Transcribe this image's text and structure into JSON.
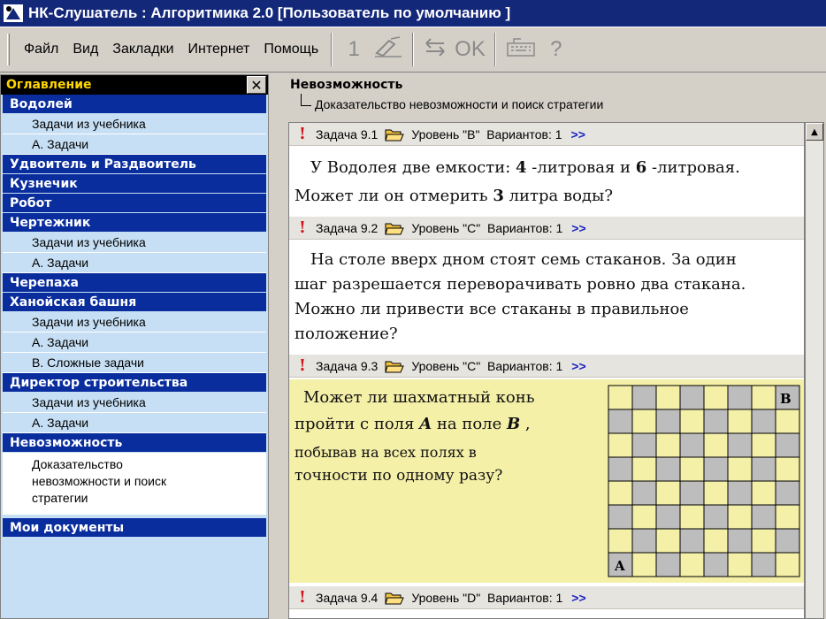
{
  "window": {
    "title": "НК-Слушатель : Алгоритмика 2.0 [Пользователь по умолчанию ]"
  },
  "menu": {
    "items": [
      "Файл",
      "Вид",
      "Закладки",
      "Интернет",
      "Помощь"
    ]
  },
  "toolbar": {
    "btn_one": "1",
    "btn_ok": "OK",
    "btn_help": "?"
  },
  "sidebar": {
    "header": "Оглавление",
    "close": "✕",
    "cat_vodoley": "Водолей",
    "sub_vodoley_1": "Задачи из учебника",
    "sub_vodoley_2": "А. Задачи",
    "cat_udvoitel": "Удвоитель и Раздвоитель",
    "cat_kuznechik": "Кузнечик",
    "cat_robot": "Робот",
    "cat_chertezhnik": "Чертежник",
    "sub_chert_1": "Задачи из учебника",
    "sub_chert_2": "А. Задачи",
    "cat_cherepaha": "Черепаха",
    "cat_hanoi": "Ханойская башня",
    "sub_hanoi_1": "Задачи из учебника",
    "sub_hanoi_2": "А. Задачи",
    "sub_hanoi_3": "В. Сложные задачи",
    "cat_direktor": "Директор строительства",
    "sub_dir_1": "Задачи из учебника",
    "sub_dir_2": "А. Задачи",
    "cat_nevozm": "Невозможность",
    "sel_line1": "Доказательство",
    "sel_line2": "невозможности и поиск",
    "sel_line3": "стратегии",
    "cat_docs": "Мои документы"
  },
  "breadcrumb": {
    "title": "Невозможность",
    "subtitle": "Доказательство невозможности и поиск стратегии"
  },
  "tasks": [
    {
      "num": "Задача 9.1",
      "level": "Уровень \"В\"",
      "variants": "Вариантов: 1",
      "more": ">>",
      "line1_a": "У Водолея две емкости: ",
      "line1_n1": "4",
      "line1_b": " -литровая и ",
      "line1_n2": "6",
      "line1_c": " -литровая.",
      "line2_a": "Может ли он отмерить ",
      "line2_n": "3",
      "line2_b": " литра воды?"
    },
    {
      "num": "Задача 9.2",
      "level": "Уровень \"С\"",
      "variants": "Вариантов: 1",
      "more": ">>",
      "line1": "На столе вверх дном стоят семь стаканов. За один",
      "line2": "шаг разрешается переворачивать ровно два стакана.",
      "line3": "Можно ли привести все стаканы в правильное",
      "line4": "положение?"
    },
    {
      "num": "Задача 9.3",
      "level": "Уровень \"С\"",
      "variants": "Вариантов: 1",
      "more": ">>",
      "line1": "Может ли шахматный конь",
      "line2_a": "пройти с поля ",
      "line2_A": "A",
      "line2_b": " на поле ",
      "line2_B": "B",
      "line2_c": " ,",
      "line3": "побывав на всех полях в",
      "line4": "точности по одному разу?",
      "corner_a": "A",
      "corner_b": "B"
    },
    {
      "num": "Задача 9.4",
      "level": "Уровень \"D\"",
      "variants": "Вариантов: 1",
      "more": ">>"
    }
  ],
  "colors": {
    "title_bg": "#14287a",
    "category_bg": "#0a2d9e",
    "sidebar_bg": "#c6dff4",
    "header_text": "#ffd700",
    "task_highlight": "#f5f0a8",
    "board_light": "#f5f0a8",
    "board_dark": "#bdbdbd",
    "exclam": "#d0101a",
    "arrows": "#1a24c4"
  }
}
